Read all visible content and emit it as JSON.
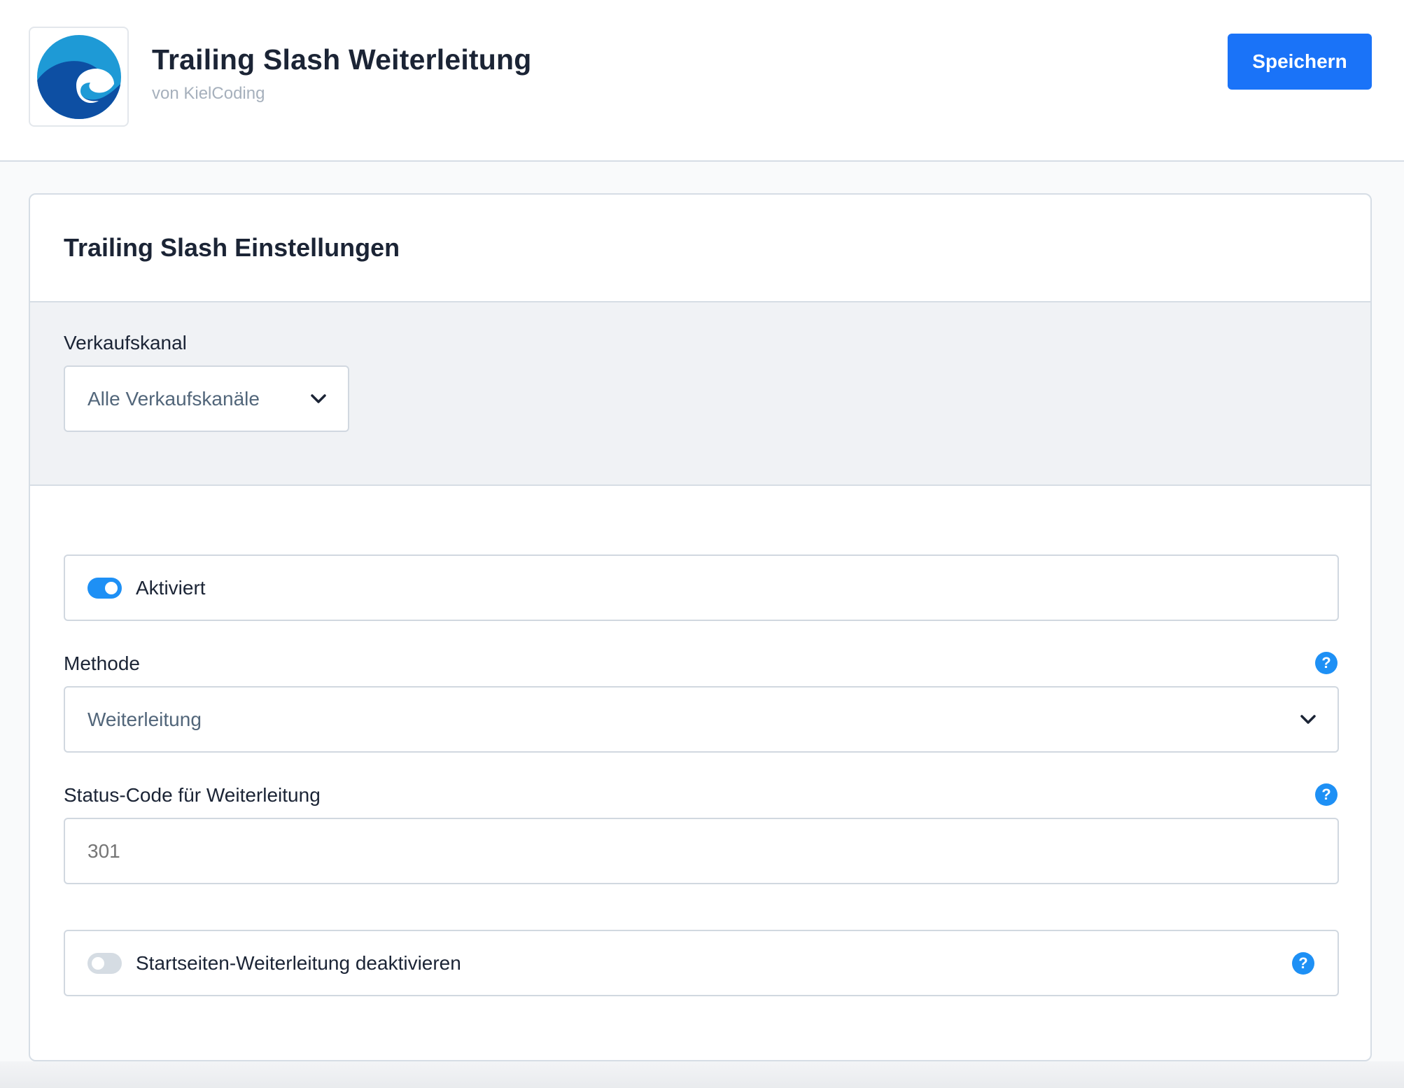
{
  "header": {
    "title": "Trailing Slash Weiterleitung",
    "vendor": "von KielCoding",
    "save_label": "Speichern",
    "logo_icon": "wave-logo-icon",
    "accent_color": "#1a73f8"
  },
  "card": {
    "title": "Trailing Slash Einstellungen",
    "sales_channel": {
      "label": "Verkaufskanal",
      "value": "Alle Verkaufskanäle"
    },
    "activated": {
      "label": "Aktiviert",
      "checked": true
    },
    "method": {
      "label": "Methode",
      "value": "Weiterleitung",
      "help_icon": "question-icon"
    },
    "status_code": {
      "label": "Status-Code für Weiterleitung",
      "placeholder": "301",
      "help_icon": "question-icon"
    },
    "homepage_redirect": {
      "label": "Startseiten-Weiterleitung deaktivieren",
      "checked": false,
      "help_icon": "question-icon"
    }
  }
}
